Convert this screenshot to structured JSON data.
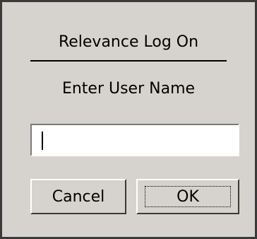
{
  "dialog": {
    "title": "Relevance Log On",
    "prompt": "Enter User Name",
    "username_field": {
      "value": "",
      "placeholder": ""
    },
    "buttons": {
      "cancel_label": "Cancel",
      "ok_label": "OK"
    }
  },
  "colors": {
    "dialog_background": "#d6d3ce",
    "field_background": "#ffffff",
    "border_dark": "#3a3a3a"
  }
}
